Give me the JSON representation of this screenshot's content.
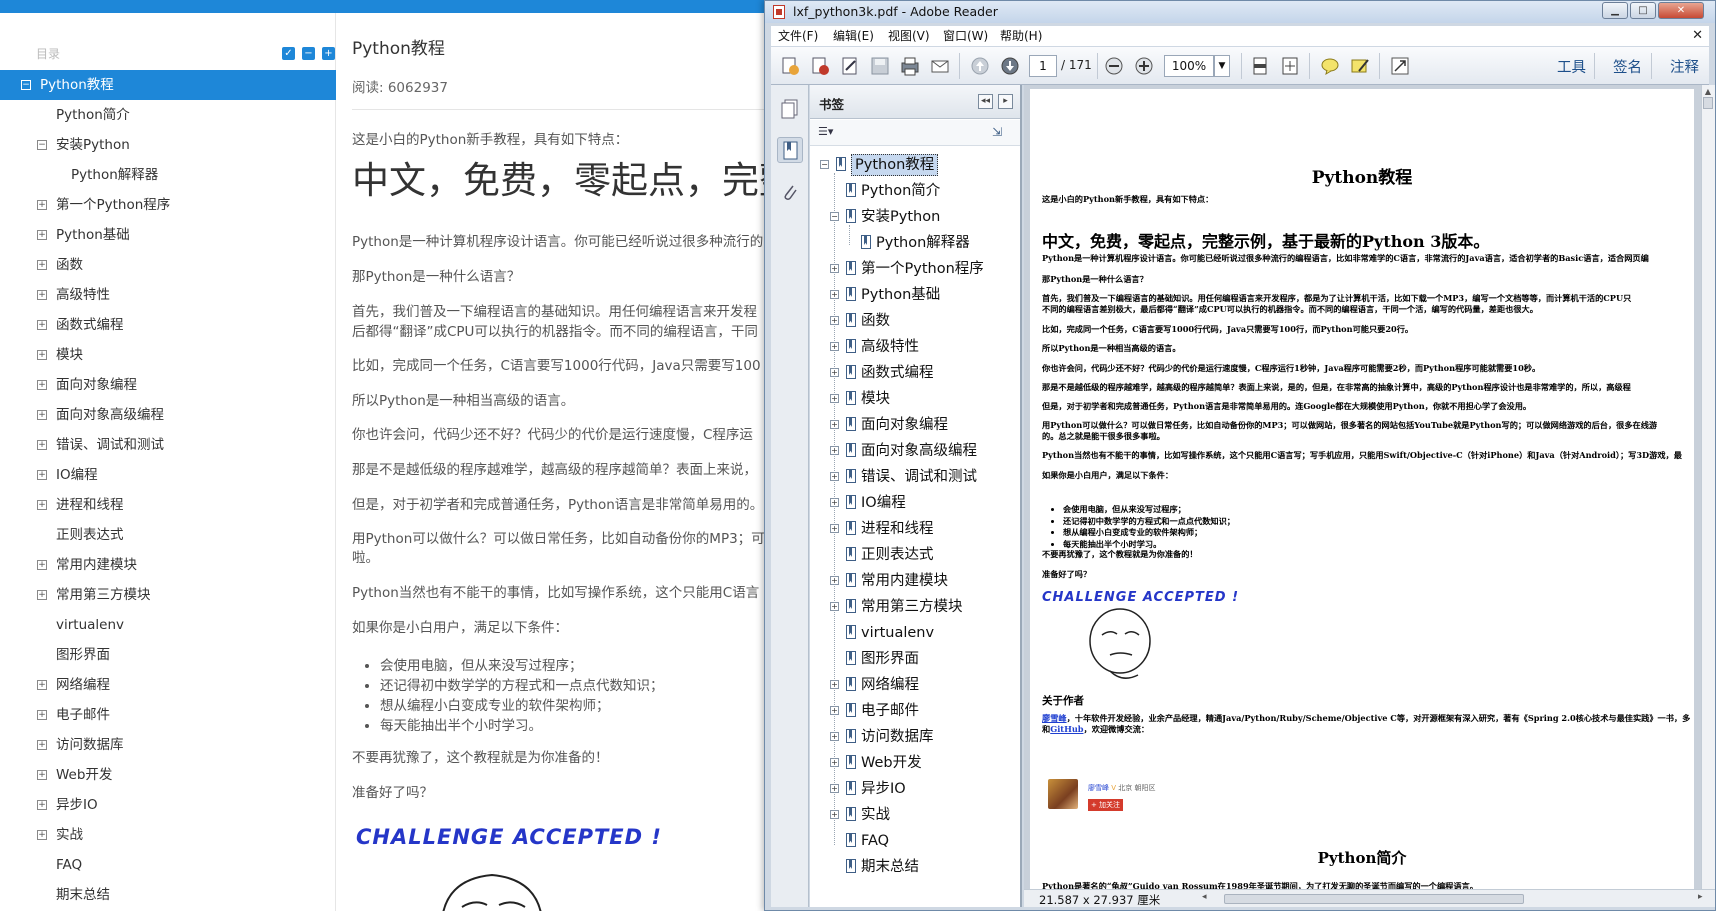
{
  "web": {
    "toc_header": "目录",
    "toc": [
      {
        "label": "Python教程",
        "level": 1,
        "expander": "⊟",
        "active": true
      },
      {
        "label": "Python简介",
        "level": 2,
        "expander": ""
      },
      {
        "label": "安装Python",
        "level": 2,
        "expander": "−"
      },
      {
        "label": "Python解释器",
        "level": 3,
        "expander": ""
      },
      {
        "label": "第一个Python程序",
        "level": 2,
        "expander": "+"
      },
      {
        "label": "Python基础",
        "level": 2,
        "expander": "+"
      },
      {
        "label": "函数",
        "level": 2,
        "expander": "+"
      },
      {
        "label": "高级特性",
        "level": 2,
        "expander": "+"
      },
      {
        "label": "函数式编程",
        "level": 2,
        "expander": "+"
      },
      {
        "label": "模块",
        "level": 2,
        "expander": "+"
      },
      {
        "label": "面向对象编程",
        "level": 2,
        "expander": "+"
      },
      {
        "label": "面向对象高级编程",
        "level": 2,
        "expander": "+"
      },
      {
        "label": "错误、调试和测试",
        "level": 2,
        "expander": "+"
      },
      {
        "label": "IO编程",
        "level": 2,
        "expander": "+"
      },
      {
        "label": "进程和线程",
        "level": 2,
        "expander": "+"
      },
      {
        "label": "正则表达式",
        "level": 2,
        "expander": ""
      },
      {
        "label": "常用内建模块",
        "level": 2,
        "expander": "+"
      },
      {
        "label": "常用第三方模块",
        "level": 2,
        "expander": "+"
      },
      {
        "label": "virtualenv",
        "level": 2,
        "expander": ""
      },
      {
        "label": "图形界面",
        "level": 2,
        "expander": ""
      },
      {
        "label": "网络编程",
        "level": 2,
        "expander": "+"
      },
      {
        "label": "电子邮件",
        "level": 2,
        "expander": "+"
      },
      {
        "label": "访问数据库",
        "level": 2,
        "expander": "+"
      },
      {
        "label": "Web开发",
        "level": 2,
        "expander": "+"
      },
      {
        "label": "异步IO",
        "level": 2,
        "expander": "+"
      },
      {
        "label": "实战",
        "level": 2,
        "expander": "+"
      },
      {
        "label": "FAQ",
        "level": 2,
        "expander": ""
      },
      {
        "label": "期末总结",
        "level": 2,
        "expander": ""
      }
    ],
    "article": {
      "title": "Python教程",
      "reads": "阅读: 6062937",
      "intro": "这是小白的Python新手教程，具有如下特点：",
      "big": "中文，免费，零起点，完整",
      "paras": [
        "Python是一种计算机程序设计语言。你可能已经听说过很多种流行的",
        "那Python是一种什么语言？",
        "首先，我们普及一下编程语言的基础知识。用任何编程语言来开发程",
        "后都得“翻译”成CPU可以执行的机器指令。而不同的编程语言，干同",
        "比如，完成同一个任务，C语言要写1000行代码，Java只需要写100",
        "所以Python是一种相当高级的语言。",
        "你也许会问，代码少还不好？代码少的代价是运行速度慢，C程序运",
        "那是不是越低级的程序越难学，越高级的程序越简单？表面上来说，",
        "但是，对于初学者和完成普通任务，Python语言是非常简单易用的。",
        "用Python可以做什么？可以做日常任务，比如自动备份你的MP3；可",
        "啦。",
        "Python当然也有不能干的事情，比如写操作系统，这个只能用C语言",
        "如果你是小白用户，满足以下条件：",
        "不要再犹豫了，这个教程就是为你准备的！",
        "准备好了吗？"
      ],
      "bullets": [
        "会使用电脑，但从来没写过程序；",
        "还记得初中数学学的方程式和一点点代数知识；",
        "想从编程小白变成专业的软件架构师；",
        "每天能抽出半个小时学习。"
      ],
      "challenge": "CHALLENGE ACCEPTED !"
    }
  },
  "reader": {
    "title": "lxf_python3k.pdf - Adobe Reader",
    "menu": [
      "文件(F)",
      "编辑(E)",
      "视图(V)",
      "窗口(W)",
      "帮助(H)"
    ],
    "page_current": "1",
    "page_total": "/ 171",
    "zoom": "100%",
    "tools_label": "工具",
    "sign_label": "签名",
    "comment_label": "注释",
    "bookmarks_title": "书签",
    "page_size": "21.587 x 27.937 厘米",
    "bookmarks": [
      {
        "label": "Python教程",
        "depth": 0,
        "expander": "−",
        "selected": true
      },
      {
        "label": "Python简介",
        "depth": 1,
        "expander": ""
      },
      {
        "label": "安装Python",
        "depth": 1,
        "expander": "−"
      },
      {
        "label": "Python解释器",
        "depth": 2,
        "expander": ""
      },
      {
        "label": "第一个Python程序",
        "depth": 1,
        "expander": "+"
      },
      {
        "label": "Python基础",
        "depth": 1,
        "expander": "+"
      },
      {
        "label": "函数",
        "depth": 1,
        "expander": "+"
      },
      {
        "label": "高级特性",
        "depth": 1,
        "expander": "+"
      },
      {
        "label": "函数式编程",
        "depth": 1,
        "expander": "+"
      },
      {
        "label": "模块",
        "depth": 1,
        "expander": "+"
      },
      {
        "label": "面向对象编程",
        "depth": 1,
        "expander": "+"
      },
      {
        "label": "面向对象高级编程",
        "depth": 1,
        "expander": "+"
      },
      {
        "label": "错误、调试和测试",
        "depth": 1,
        "expander": "+"
      },
      {
        "label": "IO编程",
        "depth": 1,
        "expander": "+"
      },
      {
        "label": "进程和线程",
        "depth": 1,
        "expander": "+"
      },
      {
        "label": "正则表达式",
        "depth": 1,
        "expander": ""
      },
      {
        "label": "常用内建模块",
        "depth": 1,
        "expander": "+"
      },
      {
        "label": "常用第三方模块",
        "depth": 1,
        "expander": "+"
      },
      {
        "label": "virtualenv",
        "depth": 1,
        "expander": ""
      },
      {
        "label": "图形界面",
        "depth": 1,
        "expander": ""
      },
      {
        "label": "网络编程",
        "depth": 1,
        "expander": "+"
      },
      {
        "label": "电子邮件",
        "depth": 1,
        "expander": "+"
      },
      {
        "label": "访问数据库",
        "depth": 1,
        "expander": "+"
      },
      {
        "label": "Web开发",
        "depth": 1,
        "expander": "+"
      },
      {
        "label": "异步IO",
        "depth": 1,
        "expander": "+"
      },
      {
        "label": "实战",
        "depth": 1,
        "expander": "+"
      },
      {
        "label": "FAQ",
        "depth": 1,
        "expander": ""
      },
      {
        "label": "期末总结",
        "depth": 1,
        "expander": ""
      }
    ],
    "pdf": {
      "title": "Python教程",
      "intro": "这是小白的Python新手教程，具有如下特点：",
      "big": "中文，免费，零起点，完整示例，基于最新的Python 3版本。",
      "paras": [
        "Python是一种计算机程序设计语言。你可能已经听说过很多种流行的编程语言，比如非常难学的C语言，非常流行的Java语言，适合初学者的Basic语言，适合网页编",
        "那Python是一种什么语言？",
        "首先，我们普及一下编程语言的基础知识。用任何编程语言来开发程序，都是为了让计算机干活，比如下载一个MP3，编写一个文档等等，而计算机干活的CPU只",
        "不同的编程语言差别极大，最后都得“翻译”成CPU可以执行的机器指令。而不同的编程语言，干同一个活，编写的代码量，差距也很大。",
        "比如，完成同一个任务，C语言要写1000行代码，Java只需要写100行，而Python可能只要20行。",
        "所以Python是一种相当高级的语言。",
        "你也许会问，代码少还不好？代码少的代价是运行速度慢，C程序运行1秒钟，Java程序可能需要2秒，而Python程序可能就需要10秒。",
        "那是不是越低级的程序越难学，越高级的程序越简单？表面上来说，是的，但是，在非常高的抽象计算中，高级的Python程序设计也是非常难学的，所以，高级程",
        "但是，对于初学者和完成普通任务，Python语言是非常简单易用的。连Google都在大规模使用Python，你就不用担心学了会没用。",
        "用Python可以做什么？可以做日常任务，比如自动备份你的MP3；可以做网站，很多著名的网站包括YouTube就是Python写的；可以做网络游戏的后台，很多在线游",
        "的。总之就是能干很多很多事啦。",
        "Python当然也有不能干的事情，比如写操作系统，这个只能用C语言写；写手机应用，只能用Swift/Objective-C（针对iPhone）和Java（针对Android）；写3D游戏，最",
        "如果你是小白用户，满足以下条件：",
        "不要再犹豫了，这个教程就是为你准备的！",
        "准备好了吗？"
      ],
      "bullets": [
        "会使用电脑，但从来没写过程序；",
        "还记得初中数学学的方程式和一点点代数知识；",
        "想从编程小白变成专业的软件架构师；",
        "每天能抽出半个小时学习。"
      ],
      "challenge": "CHALLENGE ACCEPTED !",
      "about_title": "关于作者",
      "about_link": "廖雪峰",
      "about_line1": "，十年软件开发经验，业余产品经理，精通Java/Python/Ruby/Scheme/Objective C等，对开源框架有深入研究，著有《Spring 2.0核心技术与最佳实践》一书，多",
      "about_line2_pre": "和",
      "about_line2_link": "GitHub",
      "about_line2_post": "，欢迎微博交流：",
      "weibo_name": "廖雪峰",
      "weibo_loc": "北京 朝阳区",
      "follow_label": "+ 加关注",
      "section2_title": "Python简介",
      "section2_line": "Python是著名的“龟叔”Guido van Rossum在1989年圣诞节期间，为了打发无聊的圣诞节而编写的一个编程语言。"
    }
  },
  "icons": [
    "checkbox-icon",
    "collapse-all-icon",
    "expand-all-icon",
    "pdf-file-icon",
    "create-pdf-icon",
    "edit-icon",
    "save-icon",
    "print-icon",
    "email-icon",
    "prev-page-icon",
    "next-page-icon",
    "zoom-out-icon",
    "zoom-in-icon",
    "fit-page-icon",
    "fit-width-icon",
    "comment-icon",
    "highlight-icon",
    "fullscreen-icon",
    "pages-icon",
    "bookmark-icon",
    "attachment-icon",
    "bookmark-options-icon",
    "new-bookmark-icon"
  ],
  "colors": {
    "accent": "#1e87d8",
    "reader_frame": "#cfd8e3",
    "challenge": "#2536c8"
  }
}
